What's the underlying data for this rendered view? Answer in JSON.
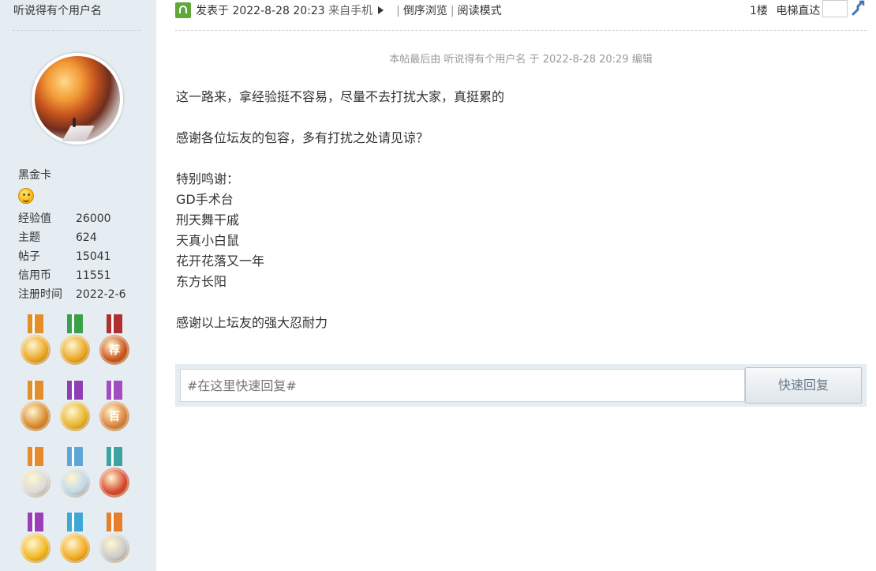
{
  "sidebar": {
    "username": "听说得有个用户名",
    "level": "黑金卡",
    "emoji_icon": "smiley-face-icon",
    "stats": [
      {
        "label": "经验值",
        "value": "26000"
      },
      {
        "label": "主题",
        "value": "624"
      },
      {
        "label": "帖子",
        "value": "15041"
      },
      {
        "label": "信用币",
        "value": "11551"
      },
      {
        "label": "注册时间",
        "value": "2022-2-6"
      }
    ],
    "medals": [
      {
        "icon": "star-medal-icon",
        "ribbon": "#e28f2a",
        "disc": "#e9a521"
      },
      {
        "icon": "people-medal-icon",
        "ribbon": "#3aa14a",
        "disc": "#e9a521"
      },
      {
        "icon": "recommend-medal-icon",
        "ribbon": "#b03030",
        "disc": "#c8541c",
        "text": "荐"
      },
      {
        "icon": "checker-medal-icon",
        "ribbon": "#e08f2a",
        "disc": "#d9882a"
      },
      {
        "icon": "clock-medal-icon",
        "ribbon": "#8e3fb5",
        "disc": "#e8b22a"
      },
      {
        "icon": "hundred-medal-icon",
        "ribbon": "#a24dc0",
        "disc": "#d9823c",
        "text": "百"
      },
      {
        "icon": "gear-medal-icon",
        "ribbon": "#e78a2a",
        "disc": "#d9d9d9"
      },
      {
        "icon": "drop-medal-icon",
        "ribbon": "#5da7d8",
        "disc": "#bfd7ea"
      },
      {
        "icon": "circle-medal-icon",
        "ribbon": "#3ca3a0",
        "disc": "#d6452a"
      },
      {
        "icon": "eye-medal-icon",
        "ribbon": "#9b3fb8",
        "disc": "#f2b51e"
      },
      {
        "icon": "card-medal-icon",
        "ribbon": "#3ea7d6",
        "disc": "#f2a81e"
      },
      {
        "icon": "flower-medal-icon",
        "ribbon": "#e77f2a",
        "disc": "#c9c9c9"
      }
    ]
  },
  "header": {
    "posted_prefix": "发表于 2022-8-28 20:23",
    "from_device": "来自手机",
    "reverse_view": "倒序浏览",
    "read_mode": "阅读模式",
    "floor": "1楼",
    "elevator": "电梯直达",
    "post_icon": "post-author-icon",
    "elevator_icon": "jump-arrow-icon"
  },
  "post": {
    "edit_note": "本帖最后由 听说得有个用户名 于 2022-8-28 20:29 编辑",
    "line1": "这一路来，拿经验挺不容易，尽量不去打扰大家，真挺累的",
    "line2": "感谢各位坛友的包容，多有打扰之处请见谅？",
    "thanks_title": "特别鸣谢：",
    "thanks_names": [
      "GD手术台",
      "刑天舞干戚",
      "天真小白鼠",
      "花开花落又一年",
      "东方长阳"
    ],
    "line_end": "感谢以上坛友的强大忍耐力"
  },
  "reply": {
    "placeholder": "#在这里快速回复#",
    "button": "快速回复"
  }
}
